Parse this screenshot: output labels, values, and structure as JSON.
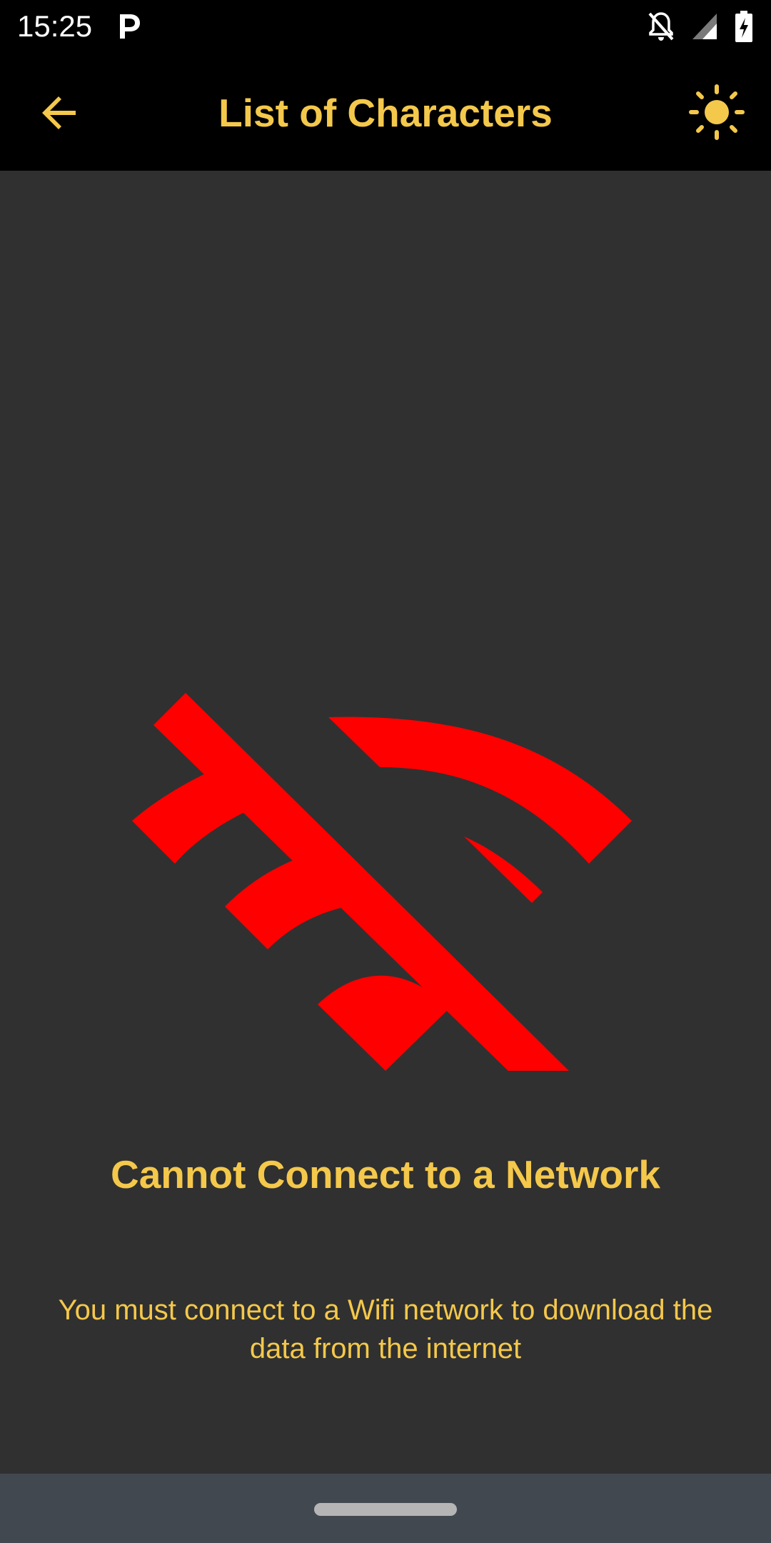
{
  "status_bar": {
    "time": "15:25",
    "notification_icon": "parking-p-icon",
    "icons": [
      "notifications-off-icon",
      "cell-signal-icon",
      "battery-charging-icon"
    ]
  },
  "app_bar": {
    "back_icon": "arrow-back-icon",
    "title": "List of Characters",
    "theme_icon": "sun-icon"
  },
  "empty_state": {
    "icon": "wifi-off-icon",
    "title": "Cannot Connect to a Network",
    "message": "You must connect to a Wifi network to download the data from the internet"
  },
  "colors": {
    "accent": "#f4c84b",
    "error_icon": "#ff0000",
    "background": "#303030",
    "bar": "#000000",
    "nav_bar": "#424850"
  }
}
